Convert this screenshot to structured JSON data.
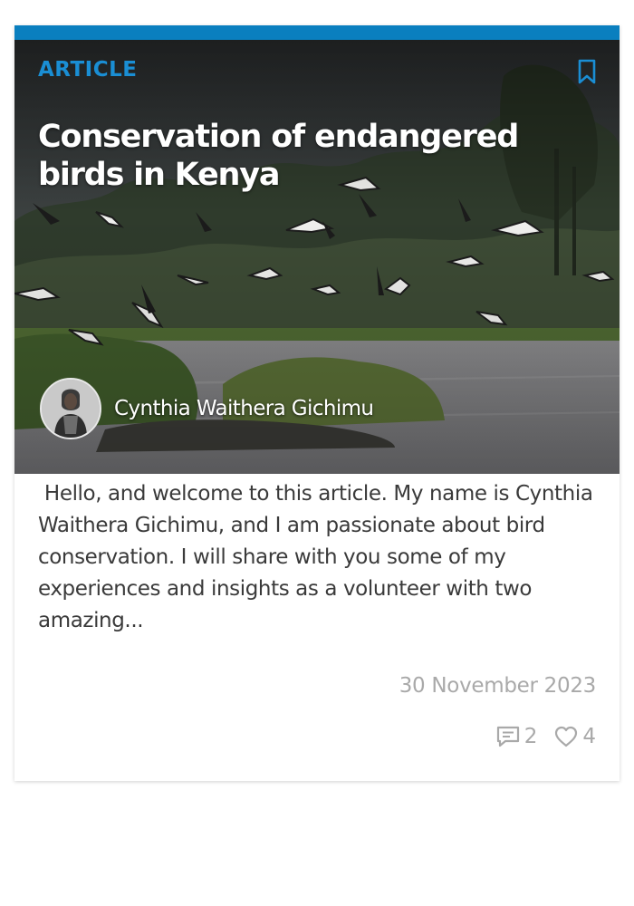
{
  "card": {
    "category": "ARTICLE",
    "title": "Conservation of endangered birds in Kenya",
    "author": {
      "name": "Cynthia Waithera Gichimu"
    },
    "excerpt": " Hello, and welcome to this article. My name is Cynthia Waithera Gichimu, and I am passionate about bird conservation. I will share with you some of my experiences and insights as a volunteer with two amazing...",
    "date": "30 November 2023",
    "stats": {
      "comments": "2",
      "likes": "4"
    },
    "icons": {
      "bookmark": "bookmark-icon",
      "comments": "comment-icon",
      "likes": "heart-icon"
    },
    "colors": {
      "accent": "#0a7fbf",
      "category": "#1a8ed4",
      "meta": "#a9a9a9"
    }
  }
}
